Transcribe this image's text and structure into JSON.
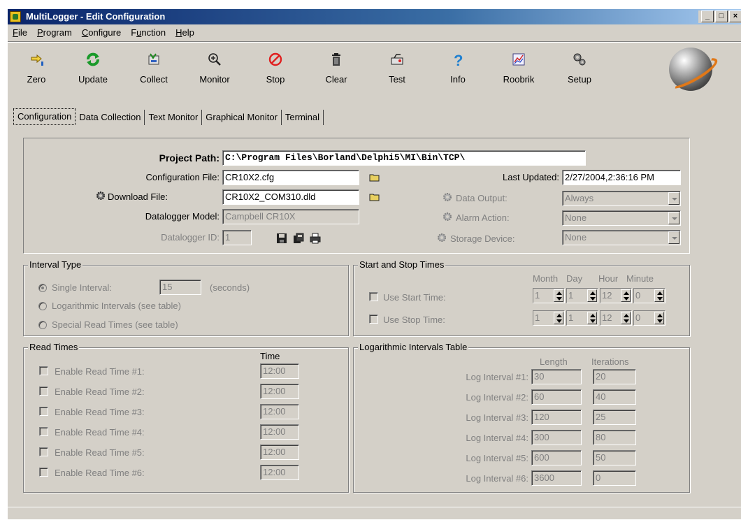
{
  "window": {
    "title": "MultiLogger - Edit Configuration",
    "controls": {
      "minimize": "_",
      "maximize": "□",
      "close": "×"
    }
  },
  "menu": [
    "File",
    "Program",
    "Configure",
    "Function",
    "Help"
  ],
  "menu_mnemonics": [
    "F",
    "P",
    "C",
    "u",
    "H"
  ],
  "toolbar": {
    "buttons": [
      {
        "label": "Zero",
        "icon": "zero-icon"
      },
      {
        "label": "Update",
        "icon": "refresh-icon"
      },
      {
        "label": "Collect",
        "icon": "collect-icon"
      },
      {
        "label": "Monitor",
        "icon": "magnifier-icon"
      },
      {
        "label": "Stop",
        "icon": "stop-icon"
      },
      {
        "label": "Clear",
        "icon": "trash-icon"
      },
      {
        "label": "Test",
        "icon": "test-icon"
      },
      {
        "label": "Info",
        "icon": "question-icon"
      },
      {
        "label": "Roobrik",
        "icon": "chart-icon"
      },
      {
        "label": "Setup",
        "icon": "setup-icon"
      }
    ]
  },
  "tabs": [
    "Configuration",
    "Data Collection",
    "Text Monitor",
    "Graphical Monitor",
    "Terminal"
  ],
  "config": {
    "project_path_label": "Project Path:",
    "project_path": "C:\\Program Files\\Borland\\Delphi5\\MI\\Bin\\TCP\\",
    "config_file_label": "Configuration File:",
    "config_file": "CR10X2.cfg",
    "download_file_label": "Download File:",
    "download_file": "CR10X2_COM310.dld",
    "datalogger_model_label": "Datalogger Model:",
    "datalogger_model": "Campbell CR10X",
    "datalogger_id_label": "Datalogger ID:",
    "datalogger_id": "1",
    "last_updated_label": "Last Updated:",
    "last_updated": "2/27/2004,2:36:16 PM",
    "data_output_label": "Data Output:",
    "data_output": "Always",
    "alarm_action_label": "Alarm Action:",
    "alarm_action": "None",
    "storage_device_label": "Storage Device:",
    "storage_device": "None"
  },
  "interval": {
    "title": "Interval Type",
    "single_label": "Single Interval:",
    "single_value": "15",
    "single_units": "(seconds)",
    "log_label": "Logarithmic Intervals (see table)",
    "special_label": "Special Read Times (see table)"
  },
  "startstop": {
    "title": "Start and Stop Times",
    "headers": [
      "Month",
      "Day",
      "Hour",
      "Minute"
    ],
    "start_label": "Use Start Time:",
    "stop_label": "Use Stop Time:",
    "start_values": [
      "1",
      "1",
      "12",
      "0"
    ],
    "stop_values": [
      "1",
      "1",
      "12",
      "0"
    ]
  },
  "readtimes": {
    "title": "Read Times",
    "time_header": "Time",
    "rows": [
      {
        "label": "Enable Read Time #1:",
        "time": "12:00"
      },
      {
        "label": "Enable Read Time #2:",
        "time": "12:00"
      },
      {
        "label": "Enable Read Time #3:",
        "time": "12:00"
      },
      {
        "label": "Enable Read Time #4:",
        "time": "12:00"
      },
      {
        "label": "Enable Read Time #5:",
        "time": "12:00"
      },
      {
        "label": "Enable Read Time #6:",
        "time": "12:00"
      }
    ]
  },
  "logtable": {
    "title": "Logarithmic Intervals Table",
    "length_header": "Length",
    "iterations_header": "Iterations",
    "rows": [
      {
        "label": "Log Interval #1:",
        "length": "30",
        "iterations": "20"
      },
      {
        "label": "Log Interval #2:",
        "length": "60",
        "iterations": "40"
      },
      {
        "label": "Log Interval #3:",
        "length": "120",
        "iterations": "25"
      },
      {
        "label": "Log Interval #4:",
        "length": "300",
        "iterations": "80"
      },
      {
        "label": "Log Interval #5:",
        "length": "600",
        "iterations": "50"
      },
      {
        "label": "Log Interval #6:",
        "length": "3600",
        "iterations": "0"
      }
    ]
  },
  "colors": {
    "face": "#d4d0c8",
    "title_start": "#0a246a",
    "title_end": "#a6caf0",
    "disabled_text": "#808080"
  }
}
